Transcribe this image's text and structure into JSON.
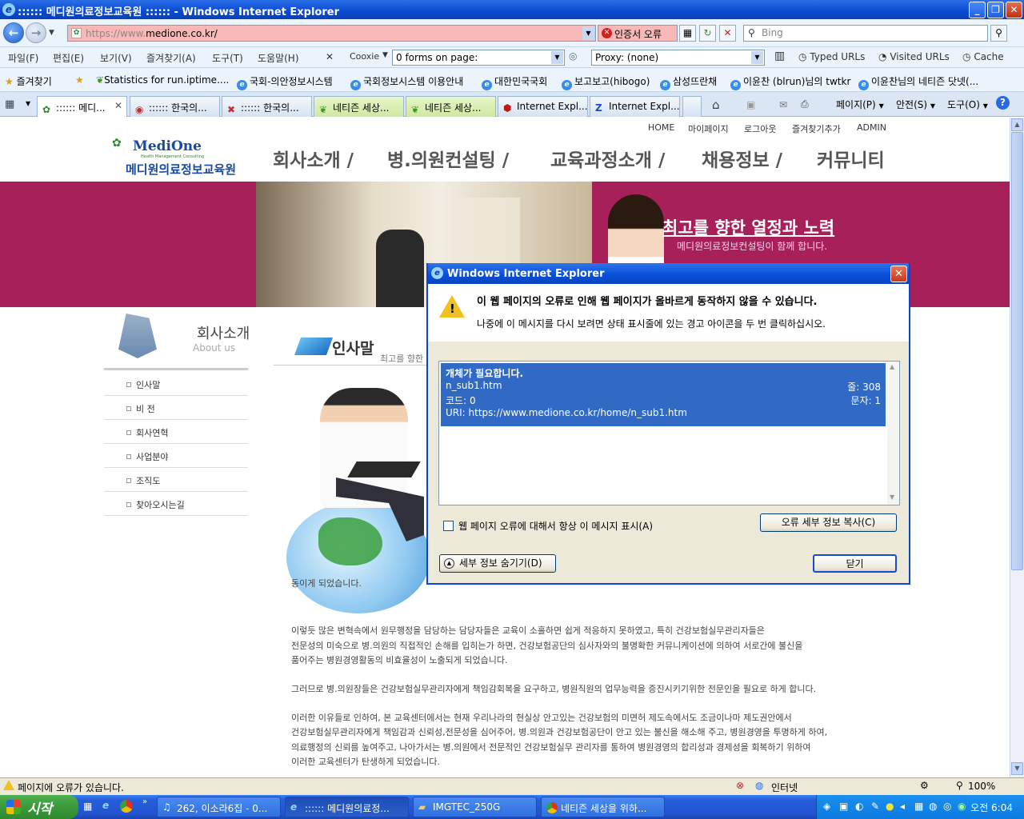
{
  "window": {
    "title": ":::::: 메디원의료정보교육원 :::::: - Windows Internet Explorer",
    "controls": [
      "_",
      "❐",
      "✕"
    ]
  },
  "address": {
    "url_prefix": "https://www.",
    "url_domain": "medione.co.kr/",
    "cert_error": "인증서 오류",
    "search_placeholder": "Bing"
  },
  "menu": {
    "items": [
      "파일(F)",
      "편집(E)",
      "보기(V)",
      "즐겨찾기(A)",
      "도구(T)",
      "도움말(H)"
    ],
    "cookie": "Cooxie",
    "forms": "0 forms on page:",
    "proxy": "Proxy: (none)",
    "typed_urls": "Typed URLs",
    "visited_urls": "Visited URLs",
    "cache": "Cache"
  },
  "favorites": {
    "label": "즐겨찾기",
    "items": [
      "Statistics for run.iptime....",
      "국회-의안정보시스템",
      "국회정보시스템 이용안내",
      "대한민국국회",
      "보고보고(hibogo)",
      "삼성뜨란채",
      "이윤찬 (blrun)님의 twtkr",
      "이윤찬님의 네티즌 닷넷(..."
    ]
  },
  "tabs": [
    ":::::: 메디...",
    ":::::: 한국의...",
    ":::::: 한국의...",
    "네티즌 세상...",
    "네티즌 세상...",
    "Internet Expl...",
    "Internet Expl..."
  ],
  "command_bar": {
    "page": "페이지(P)",
    "safety": "안전(S)",
    "tools": "도구(O)"
  },
  "site": {
    "top_links": [
      "HOME",
      "마이페이지",
      "로그아웃",
      "즐겨찾기추가",
      "ADMIN"
    ],
    "logo_en": "MediOne",
    "logo_tagline": "Health Management Consulting",
    "logo_kr": "메디원의료정보교육원",
    "nav": [
      "회사소개 /",
      "병.의원컨설팅 /",
      "교육과정소개 /",
      "채용정보 /",
      "커뮤니티"
    ],
    "slogan": "최고를 향한 열정과 노력",
    "slogan_sub": "메디원의료정보컨설팅이 함께 합니다.",
    "side_title_kr": "회사소개",
    "side_title_en": "About us",
    "side_items": [
      "인사말",
      "비 전",
      "회사연혁",
      "사업분야",
      "조직도",
      "찾아오시는길"
    ],
    "section_title": "인사말",
    "section_sub": "최고를 향한",
    "partial_line": "동이게 되었습니다.",
    "paragraphs": [
      "이렇듯 많은 변혁속에서 원무행정을 담당하는 담당자들은 교육이 소홀하면 쉽게 적응하지 못하였고, 특히 건강보험실무관리자들은",
      "전문성의 미숙으로 병.의원의 직접적인 손해를 입히는가 하면, 건강보험공단의 심사자와의 불명확한 커뮤니케이션에 의하여 서로간에 불신을",
      "품어주는 병원경영활동의 비효율성이 노출되게 되었습니다.",
      "",
      "그러므로 병.의원장들은 건강보험실무관리자에게 책임감회복을 요구하고, 병원직원의 업무능력을 증진시키기위한 전문인을 필요로 하게 합니다.",
      "",
      "이러한 이유들로 인하여, 본 교육센터에서는 현재 우리나라의 현실상 안고있는 건강보험의 미면허 제도속에서도 조금이나마 제도권안에서",
      "건강보험실무관리자에게 책임감과 신뢰성,전문성을 심어주어, 병.의원과 건강보험공단이 안고 있는 불신을 해소해 주고, 병원경영을 투명하게 하여,",
      "의료행정의 신뢰를 높여주고, 나아가서는 병.의원에서 전문적인 건강보험실무 관리자를 통하여 병원경영의 합리성과 경제성을 회복하기 위하여",
      "이러한 교육센터가 탄생하게 되었습니다."
    ]
  },
  "dialog": {
    "title": "Windows Internet Explorer",
    "message": "이 웹 페이지의 오류로 인해 웹 페이지가 올바르게 동작하지 않을 수 있습니다.",
    "hint": "나중에 이 메시지를 다시 보려면 상태 표시줄에 있는 경고 아이콘을 두 번 클릭하십시오.",
    "error": {
      "message": "개체가 필요합니다.",
      "file": "n_sub1.htm",
      "line_label": "줄: 308",
      "code": "코드: 0",
      "char_label": "문자: 1",
      "uri": "URI: https://www.medione.co.kr/home/n_sub1.htm"
    },
    "checkbox_label": "웹 페이지 오류에 대해서 항상 이 메시지 표시(A)",
    "copy_button": "오류 세부 정보 복사(C)",
    "hide_button": "세부 정보 숨기기(D)",
    "close_button": "닫기"
  },
  "statusbar": {
    "text": "페이지에 오류가 있습니다.",
    "zone": "인터넷",
    "zoom": "100%"
  },
  "taskbar": {
    "start": "시작",
    "tasks": [
      "262, 이소라6집 - 0...",
      ":::::: 메디원의료정...",
      "IMGTEC_250G",
      "네티즌 세상을 위하..."
    ],
    "clock": "오전 6:04"
  }
}
